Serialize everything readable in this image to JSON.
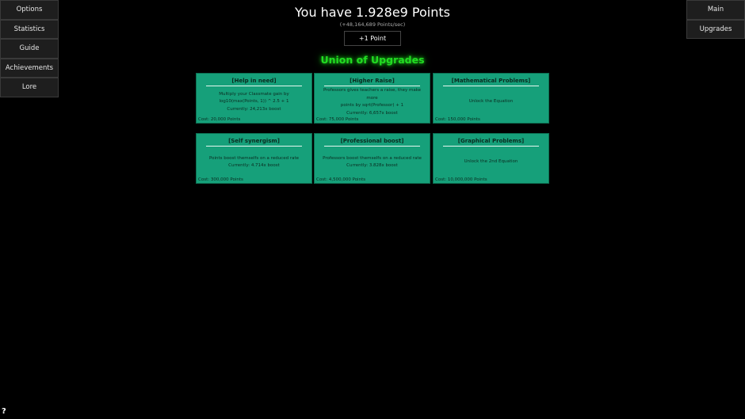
{
  "left_nav": [
    "Options",
    "Statistics",
    "Guide",
    "Achievements",
    "Lore"
  ],
  "right_nav": [
    "Main",
    "Upgrades"
  ],
  "header": {
    "points_text": "You have 1.928e9 Points",
    "rate_text": "(+48,164,689 Points/sec)",
    "plus_button": "+1 Point"
  },
  "section_title": "Union of Upgrades",
  "colors": {
    "background": "#000000",
    "upgrade_fill": "#16a07a",
    "title_glow": "#22dd22"
  },
  "upgrades": [
    {
      "title": "[Help in need]",
      "desc1": "Multiply your Classmate gain by",
      "desc2": "log10(max(Points, 1)) ^ 2.5 + 1",
      "current": "Currently: 24,213x boost",
      "cost": "Cost: 20,000 Points"
    },
    {
      "title": "[Higher Raise]",
      "desc1": "Professors gives teachers a raise, they make more",
      "desc2": "points by sqrt(Professor) + 1",
      "current": "Currently: 6,657x boost",
      "cost": "Cost: 75,000 Points"
    },
    {
      "title": "[Mathematical Problems]",
      "desc1": "Unlock the Equation",
      "desc2": "",
      "current": "",
      "cost": "Cost: 150,000 Points"
    },
    {
      "title": "[Self synergism]",
      "desc1": "Points boost themselfs on a reduced rate",
      "desc2": "",
      "current": "Currently: 4.714x boost",
      "cost": "Cost: 300,000 Points"
    },
    {
      "title": "[Professional boost]",
      "desc1": "Professors boost themselfs on a reduced rate",
      "desc2": "",
      "current": "Currently: 3.828x boost",
      "cost": "Cost: 4,500,000 Points"
    },
    {
      "title": "[Graphical Problems]",
      "desc1": "Unlock the 2nd Equation",
      "desc2": "",
      "current": "",
      "cost": "Cost: 10,000,000 Points"
    }
  ],
  "help_mark": "?"
}
